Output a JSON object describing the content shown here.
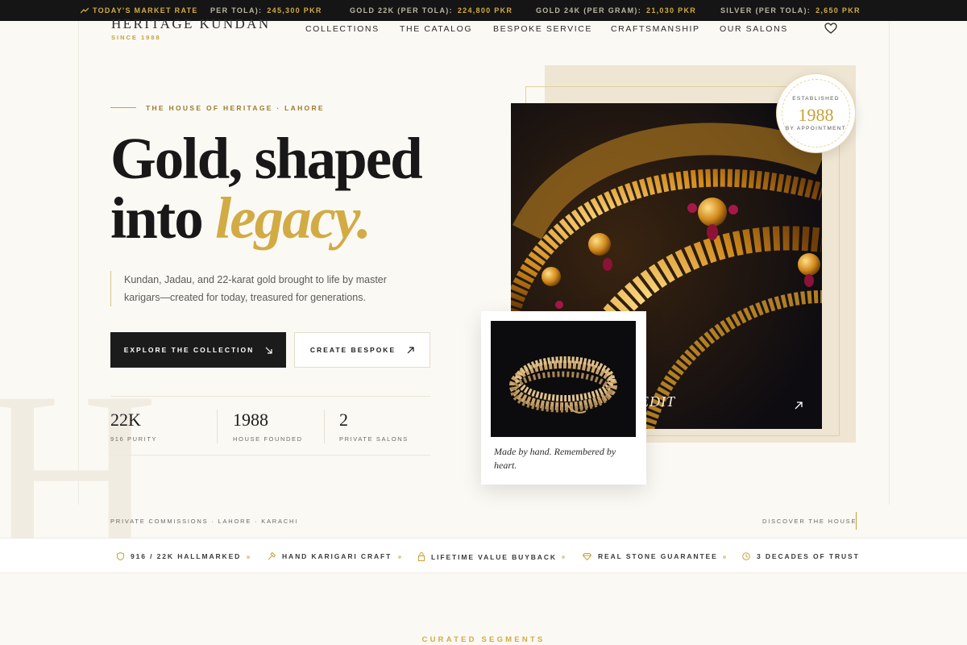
{
  "ticker": {
    "lead": "TODAY'S MARKET RATE",
    "items": [
      {
        "label": "PER TOLA):",
        "value": "245,300 PKR"
      },
      {
        "label": "GOLD 22K (PER TOLA):",
        "value": "224,800 PKR"
      },
      {
        "label": "GOLD 24K (PER GRAM):",
        "value": "21,030 PKR"
      },
      {
        "label": "SILVER (PER TOLA):",
        "value": "2,650 PKR"
      }
    ]
  },
  "brand": {
    "name": "HERITAGE KUNDAN",
    "since": "SINCE 1988"
  },
  "nav": [
    "COLLECTIONS",
    "THE CATALOG",
    "BESPOKE SERVICE",
    "CRAFTSMANSHIP",
    "OUR SALONS"
  ],
  "hero": {
    "eyebrow": "THE HOUSE OF HERITAGE · LAHORE",
    "headline_line1": "Gold, shaped",
    "headline_line2_plain": "into ",
    "headline_line2_accent": "legacy.",
    "lede": "Kundan, Jadau, and 22-karat gold brought to life by master karigars—created for today, treasured for generations.",
    "primary_button": "EXPLORE THE COLLECTION",
    "secondary_button": "CREATE BESPOKE",
    "stats": [
      {
        "value": "22K",
        "label": "916 PURITY"
      },
      {
        "value": "1988",
        "label": "HOUSE FOUNDED"
      },
      {
        "value": "2",
        "label": "PRIVATE SALONS"
      }
    ],
    "photo_caption": "EDIT",
    "badge": {
      "top": "ESTABLISHED",
      "year": "1988",
      "bottom": "BY APPOINTMENT"
    },
    "card_caption": "Made by hand. Remembered by heart."
  },
  "strip": {
    "left": "PRIVATE COMMISSIONS · LAHORE · KARACHI",
    "right": "DISCOVER THE HOUSE"
  },
  "trust": [
    {
      "icon": "shield-icon",
      "label": "916 / 22K HALLMARKED"
    },
    {
      "icon": "hammer-icon",
      "label": "HAND KARIGARI CRAFT"
    },
    {
      "icon": "lock-icon",
      "label": "LIFETIME VALUE BUYBACK"
    },
    {
      "icon": "diamond-icon",
      "label": "REAL STONE GUARANTEE"
    },
    {
      "icon": "clock-icon",
      "label": "3 DECADES OF TRUST"
    }
  ],
  "next_section": "CURATED SEGMENTS",
  "colors": {
    "gold": "#d2ab45",
    "dark": "#1b1b1b",
    "ivory": "#fbf9f4",
    "sand": "#efe5d3"
  }
}
